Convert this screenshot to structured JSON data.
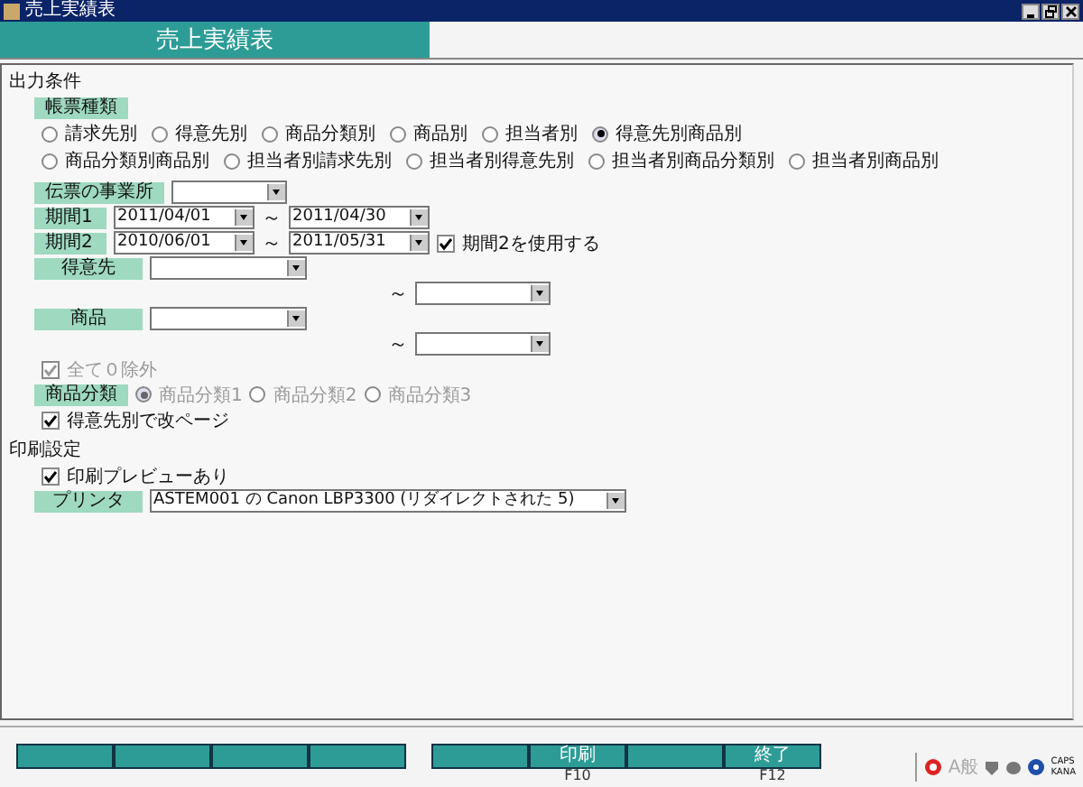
{
  "window": {
    "title": "売上実績表"
  },
  "header": {
    "title": "売上実績表"
  },
  "output_conditions": {
    "section_label": "出力条件",
    "report_type": {
      "label": "帳票種類",
      "options_line1": [
        {
          "label": "請求先別",
          "selected": false
        },
        {
          "label": "得意先別",
          "selected": false
        },
        {
          "label": "商品分類別",
          "selected": false
        },
        {
          "label": "商品別",
          "selected": false
        },
        {
          "label": "担当者別",
          "selected": false
        },
        {
          "label": "得意先別商品別",
          "selected": true
        }
      ],
      "options_line2": [
        {
          "label": "商品分類別商品別",
          "selected": false
        },
        {
          "label": "担当者別請求先別",
          "selected": false
        },
        {
          "label": "担当者別得意先別",
          "selected": false
        },
        {
          "label": "担当者別商品分類別",
          "selected": false
        },
        {
          "label": "担当者別商品別",
          "selected": false
        }
      ]
    },
    "office": {
      "label": "伝票の事業所"
    },
    "period1": {
      "label": "期間1",
      "from": "2011/04/01",
      "to": "2011/04/30",
      "separator": "～"
    },
    "period2": {
      "label": "期間2",
      "from": "2010/06/01",
      "to": "2011/05/31",
      "separator": "～",
      "use_label": "期間2を使用する",
      "checked": true
    },
    "customer": {
      "label": "得意先",
      "separator": "～"
    },
    "product": {
      "label": "商品",
      "separator": "～"
    },
    "exclude_zero": {
      "label": "全て０除外",
      "checked": true,
      "disabled": true
    },
    "product_category": {
      "label": "商品分類",
      "disabled": true,
      "options": [
        {
          "label": "商品分類1",
          "selected": true
        },
        {
          "label": "商品分類2",
          "selected": false
        },
        {
          "label": "商品分類3",
          "selected": false
        }
      ]
    },
    "page_break": {
      "label": "得意先別で改ページ",
      "checked": true
    }
  },
  "print_settings": {
    "section_label": "印刷設定",
    "preview": {
      "label": "印刷プレビューあり",
      "checked": true
    },
    "printer": {
      "label": "プリンタ",
      "value": "ASTEM001 の Canon LBP3300 (リダイレクトされた 5)"
    }
  },
  "function_keys": [
    {
      "kind": "blank"
    },
    {
      "kind": "blank"
    },
    {
      "kind": "blank"
    },
    {
      "kind": "blank"
    },
    {
      "kind": "blank"
    },
    {
      "kind": "labeled",
      "label": "印刷",
      "key": "F10"
    },
    {
      "kind": "blank"
    },
    {
      "kind": "labeled",
      "label": "終了",
      "key": "F12"
    }
  ],
  "status_bar": {
    "ime": "A般",
    "caps": "CAPS",
    "kana": "KANA"
  }
}
